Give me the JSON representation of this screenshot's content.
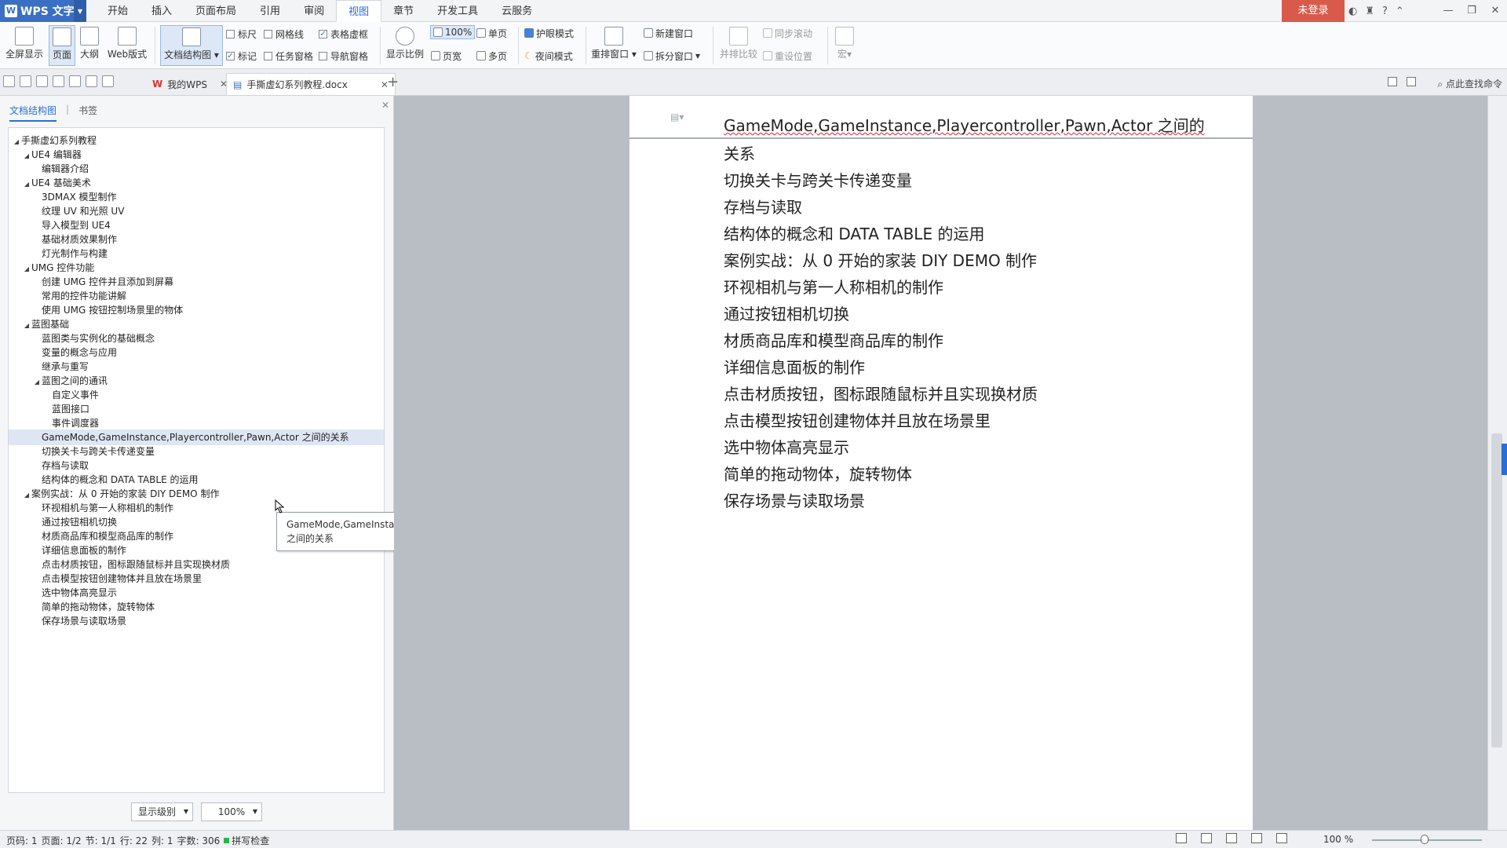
{
  "app": {
    "name": "WPS 文字",
    "login": "未登录"
  },
  "menu_tabs": [
    "开始",
    "插入",
    "页面布局",
    "引用",
    "审阅",
    "视图",
    "章节",
    "开发工具",
    "云服务"
  ],
  "menu_active": "视图",
  "ribbon": {
    "fullscreen": "全屏显示",
    "page": "页面",
    "outline": "大纲",
    "web": "Web版式",
    "docmap": "文档结构图",
    "ruler": "标尺",
    "gridline": "网格线",
    "table_border": "表格虚框",
    "mark": "标记",
    "task_pane": "任务窗格",
    "nav_pane": "导航窗格",
    "zoom": "显示比例",
    "zoom_100": "100%",
    "page_width": "页宽",
    "single_page": "单页",
    "multi_page": "多页",
    "eye_mode": "护眼模式",
    "night_mode": "夜间模式",
    "rearrange": "重排窗口",
    "new_window": "新建窗口",
    "split_window": "拆分窗口",
    "side_compare": "并排比较",
    "sync_scroll": "同步滚动",
    "reset_pos": "重设位置",
    "macro": "宏"
  },
  "doc_tabs": [
    {
      "label": "我的WPS"
    },
    {
      "label": "手撕虚幻系列教程.docx"
    }
  ],
  "find_command": "点此查找命令",
  "left_panel": {
    "tab_docmap": "文档结构图",
    "tab_bookmark": "书签",
    "tree": [
      {
        "label": "手撕虚幻系列教程",
        "level": 0,
        "exp": true
      },
      {
        "label": "UE4 编辑器",
        "level": 1,
        "exp": true
      },
      {
        "label": "编辑器介绍",
        "level": 2
      },
      {
        "label": "UE4 基础美术",
        "level": 1,
        "exp": true
      },
      {
        "label": "3DMAX 模型制作",
        "level": 2
      },
      {
        "label": "纹理 UV 和光照 UV",
        "level": 2
      },
      {
        "label": "导入模型到 UE4",
        "level": 2
      },
      {
        "label": "基础材质效果制作",
        "level": 2
      },
      {
        "label": "灯光制作与构建",
        "level": 2
      },
      {
        "label": "UMG 控件功能",
        "level": 1,
        "exp": true
      },
      {
        "label": "创建 UMG 控件并且添加到屏幕",
        "level": 2
      },
      {
        "label": "常用的控件功能讲解",
        "level": 2
      },
      {
        "label": "使用 UMG 按钮控制场景里的物体",
        "level": 2
      },
      {
        "label": "蓝图基础",
        "level": 1,
        "exp": true
      },
      {
        "label": "蓝图类与实例化的基础概念",
        "level": 2
      },
      {
        "label": "变量的概念与应用",
        "level": 2
      },
      {
        "label": "继承与重写",
        "level": 2
      },
      {
        "label": "蓝图之间的通讯",
        "level": 2,
        "exp": true
      },
      {
        "label": "自定义事件",
        "level": 3
      },
      {
        "label": "蓝图接口",
        "level": 3
      },
      {
        "label": "事件调度器",
        "level": 3
      },
      {
        "label": "GameMode,GameInstance,Playercontroller,Pawn,Actor 之间的关系",
        "level": 2,
        "sel": true
      },
      {
        "label": "切换关卡与跨关卡传递变量",
        "level": 2
      },
      {
        "label": "存档与读取",
        "level": 2
      },
      {
        "label": "结构体的概念和 DATA TABLE 的运用",
        "level": 2
      },
      {
        "label": "案例实战：从 0 开始的家装 DIY DEMO 制作",
        "level": 1,
        "exp": true
      },
      {
        "label": "环视相机与第一人称相机的制作",
        "level": 2
      },
      {
        "label": "通过按钮相机切换",
        "level": 2
      },
      {
        "label": "材质商品库和模型商品库的制作",
        "level": 2
      },
      {
        "label": "详细信息面板的制作",
        "level": 2
      },
      {
        "label": "点击材质按钮，图标跟随鼠标并且实现换材质",
        "level": 2
      },
      {
        "label": "点击模型按钮创建物体并且放在场景里",
        "level": 2
      },
      {
        "label": "选中物体高亮显示",
        "level": 2
      },
      {
        "label": "简单的拖动物体，旋转物体",
        "level": 2
      },
      {
        "label": "保存场景与读取场景",
        "level": 2
      }
    ],
    "level_select": "显示级别",
    "zoom_select": "100%",
    "tooltip_line1": "GameMode,GameInstance,Playercontroller,Pawn,Actor",
    "tooltip_line2": "之间的关系"
  },
  "document": {
    "header_line": "GameMode,GameInstance,Playercontroller,Pawn,Actor 之间的",
    "lines": [
      "关系",
      "切换关卡与跨关卡传递变量",
      "存档与读取",
      "结构体的概念和 DATA TABLE 的运用",
      "案例实战：从 0 开始的家装 DIY DEMO 制作",
      "环视相机与第一人称相机的制作",
      "通过按钮相机切换",
      "材质商品库和模型商品库的制作",
      "详细信息面板的制作",
      "点击材质按钮，图标跟随鼠标并且实现换材质",
      "点击模型按钮创建物体并且放在场景里",
      "选中物体高亮显示",
      "简单的拖动物体，旋转物体",
      "保存场景与读取场景"
    ]
  },
  "status": {
    "page_code": "页码: 1",
    "pages": "页面: 1/2",
    "section": "节: 1/1",
    "row": "行: 22",
    "col": "列: 1",
    "chars": "字数: 306",
    "spell": "拼写检查",
    "zoom": "100 %"
  },
  "colors": {
    "accent": "#2b6ed3",
    "login": "#d95a4b",
    "app": "#3a6fc4"
  }
}
